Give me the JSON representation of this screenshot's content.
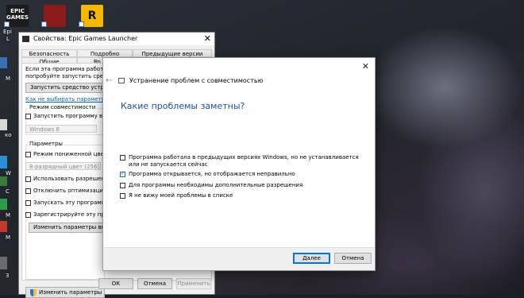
{
  "desktop": {
    "epic_icon_text": "EPIC GAMES",
    "epic_label_fragment": "Epi",
    "epic_label_fragment2": "L",
    "left_fragments": [
      "M",
      "ко",
      "W",
      "С",
      "М",
      "M",
      "3"
    ],
    "colors": {
      "accent": "#0078d7",
      "link": "#0066cc",
      "question": "#1c4f9c"
    }
  },
  "props_window": {
    "title": "Свойства: Epic Games Launcher",
    "tabs_row1": [
      "Безопасность",
      "Подробно",
      "Предыдущие версии"
    ],
    "tabs_row2": [
      "Общие",
      "Яр"
    ],
    "intro_line1": "Если эта программа работает не",
    "intro_line2": "попробуйте запустить средство у",
    "run_troubleshooter_btn": "Запустить средство устранен",
    "manual_link": "Как не выбирать параметры сов",
    "compat_group": "Режим совместимости",
    "compat_checkbox": "Запустить программу в реж",
    "compat_select": "Windows 8",
    "params_group": "Параметры",
    "reduced_color": "Режим пониженной цветност",
    "color_select": "8-разрядный цвет (256)",
    "resolution": "Использовать разрешение",
    "disable_fullscreen": "Отключить оптимизацию во",
    "run_as_admin": "Запускать эту программу от",
    "register_restart": "Зарегистрируйте эту програ",
    "dpi_btn": "Изменить параметры высо",
    "all_users_btn": "Изменить параметры для все",
    "ok": "ОК",
    "cancel": "Отмена",
    "apply": "Применить"
  },
  "dialog": {
    "title": "Устранение проблем с совместимостью",
    "question": "Какие проблемы заметны?",
    "options": [
      {
        "label": "Программа работала в предыдущих версиях Windows, но не устанавливается или не запускается сейчас",
        "checked": false
      },
      {
        "label": "Программа открывается, но отображается неправильно",
        "checked": true
      },
      {
        "label": "Для программы необходимы дополнительные разрешения",
        "checked": false
      },
      {
        "label": "Я не вижу моей проблемы в списке",
        "checked": false
      }
    ],
    "next": "Далее",
    "cancel": "Отмена"
  }
}
